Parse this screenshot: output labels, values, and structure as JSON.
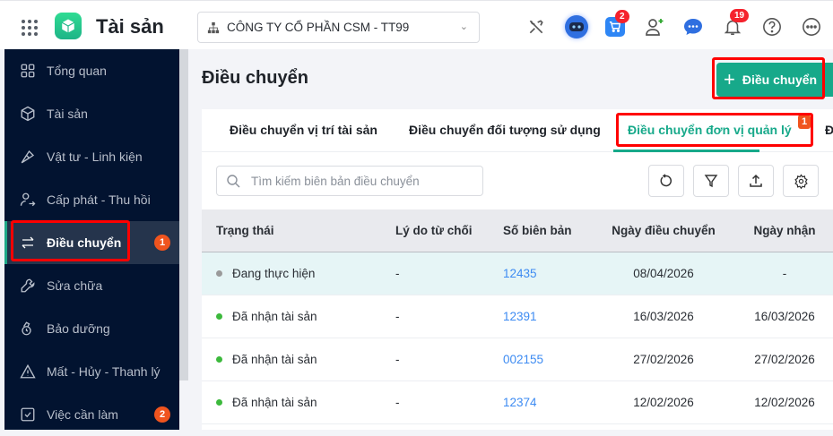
{
  "header": {
    "app_title": "Tài sản",
    "company": "CÔNG TY CỔ PHẦN CSM - TT99",
    "cart_badge": "2",
    "notification_badge": "19"
  },
  "sidebar": {
    "items": [
      {
        "label": "Tổng quan",
        "icon": "dashboard-icon"
      },
      {
        "label": "Tài sản",
        "icon": "box-icon"
      },
      {
        "label": "Vật tư - Linh kiện",
        "icon": "screwdriver-icon"
      },
      {
        "label": "Cấp phát - Thu hồi",
        "icon": "user-transfer-icon"
      },
      {
        "label": "Điều chuyển",
        "icon": "swap-icon",
        "active": true,
        "badge": "1"
      },
      {
        "label": "Sửa chữa",
        "icon": "wrench-icon"
      },
      {
        "label": "Bảo dưỡng",
        "icon": "maintenance-icon"
      },
      {
        "label": "Mất - Hủy - Thanh lý",
        "icon": "warning-icon"
      },
      {
        "label": "Việc cần làm",
        "icon": "checkbox-icon",
        "badge": "2"
      }
    ]
  },
  "main": {
    "title": "Điều chuyển",
    "add_button": "Điều chuyển",
    "tabs": [
      {
        "label": "Điều chuyển vị trí tài sản"
      },
      {
        "label": "Điều chuyển đối tượng sử dụng"
      },
      {
        "label": "Điều chuyển đơn vị quản lý",
        "active": true,
        "badge": "1"
      },
      {
        "label": "Đ"
      }
    ],
    "search_placeholder": "Tìm kiếm biên bản điều chuyển",
    "table": {
      "columns": [
        "Trạng thái",
        "Lý do từ chối",
        "Số biên bản",
        "Ngày điều chuyển",
        "Ngày nhận"
      ],
      "rows": [
        {
          "status": "Đang thực hiện",
          "status_color": "#9a9a9a",
          "reason": "-",
          "number": "12435",
          "transfer_date": "08/04/2026",
          "received_date": "-"
        },
        {
          "status": "Đã nhận tài sản",
          "status_color": "#3cb93c",
          "reason": "-",
          "number": "12391",
          "transfer_date": "16/03/2026",
          "received_date": "16/03/2026"
        },
        {
          "status": "Đã nhận tài sản",
          "status_color": "#3cb93c",
          "reason": "-",
          "number": "002155",
          "transfer_date": "27/02/2026",
          "received_date": "27/02/2026"
        },
        {
          "status": "Đã nhận tài sản",
          "status_color": "#3cb93c",
          "reason": "-",
          "number": "12374",
          "transfer_date": "12/02/2026",
          "received_date": "12/02/2026"
        }
      ]
    }
  },
  "colors": {
    "accent": "#17a98a",
    "sidebar_bg": "#021330",
    "highlight": "#ff0000",
    "link": "#3d8bf2"
  }
}
